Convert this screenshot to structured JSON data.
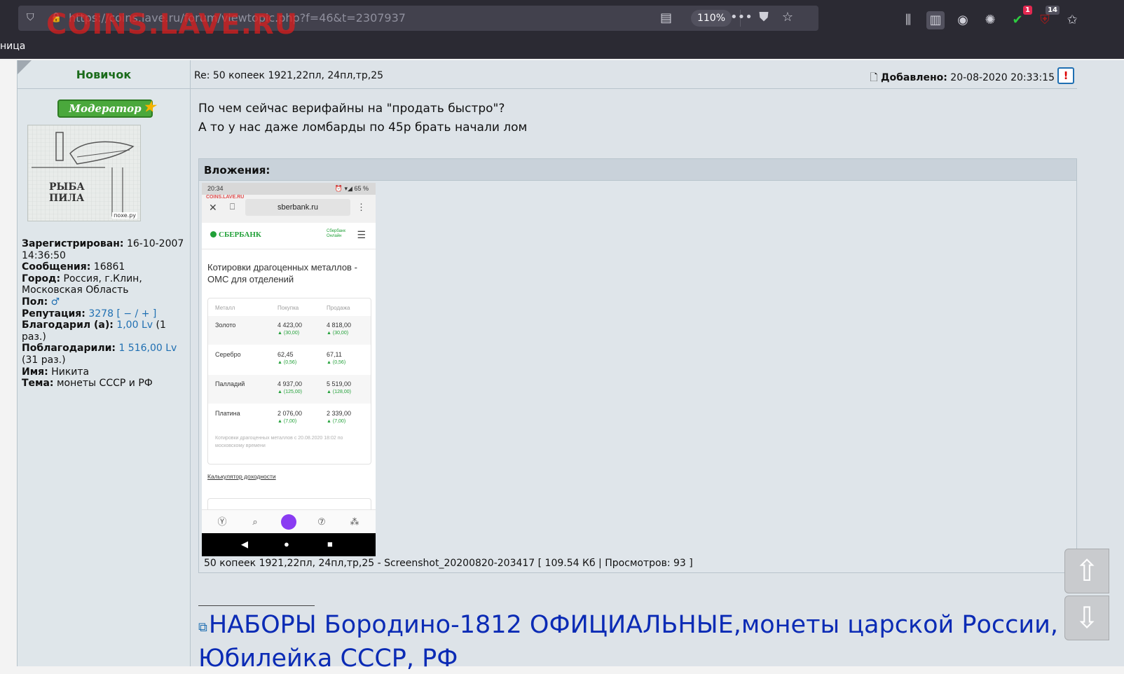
{
  "browser": {
    "url": "https://coins.lave.ru/forum/viewtopic.php?f=46&t=2307937",
    "watermark": "COINS.LAVE.RU",
    "zoom": "110%",
    "tab_fragment": "ница",
    "badges": {
      "shield": "1",
      "ublock": "14"
    },
    "icons": [
      "shield-icon",
      "lock-icon",
      "reader-view-icon",
      "more-icon",
      "pocket-icon",
      "star-icon",
      "library-icon",
      "sidebar-icon",
      "account-icon",
      "extension-icon",
      "privacy-badger-icon",
      "ublock-icon",
      "bookmark-star-icon"
    ]
  },
  "author": {
    "rank": "Новичок",
    "badge": "Модератор",
    "avatar_text_line1": "РЫБА",
    "avatar_text_line2": "ПИЛА",
    "avatar_sig": "поxe.ру",
    "registered_label": "Зарегистрирован:",
    "registered_value": "16-10-2007 14:36:50",
    "messages_label": "Сообщения:",
    "messages_value": "16861",
    "city_label": "Город:",
    "city_value": "Россия, г.Клин, Московская Область",
    "gender_label": "Пол:",
    "gender_value": "♂",
    "rep_label": "Репутация:",
    "rep_value": "3278",
    "rep_controls": "[ − / + ]",
    "thanked_label": "Благодарил (а):",
    "thanked_value": "1,00 Lv",
    "thanked_times": "(1 раз.)",
    "thanked_by_label": "Поблагодарили:",
    "thanked_by_value": "1 516,00 Lv",
    "thanked_by_times": "(31 раз.)",
    "name_label": "Имя:",
    "name_value": "Никита",
    "topic_label": "Тема:",
    "topic_value": "монеты СССР и РФ"
  },
  "post": {
    "subject": "Re: 50 копеек 1921,22пл, 24пл,тр,25",
    "added_label": "Добавлено:",
    "added_value": "20-08-2020 20:33:15",
    "report_glyph": "!",
    "line1": "По чем сейчас верифайны на \"продать быстро\"?",
    "line2": "А то у нас даже ломбарды по 45р брать начали лом",
    "attachments_title": "Вложения:",
    "attachment_caption": "50 копеек 1921,22пл, 24пл,тр,25 - Screenshot_20200820-203417 [ 109.54 Кб | Просмотров: 93 ]"
  },
  "phone": {
    "time": "20:34",
    "status_right": "⏰ ▾◢ 65 %",
    "watermark": "COINS.LAVE.RU",
    "url": "sberbank.ru",
    "bank": "СБЕРБАНК",
    "online": "Сбербанк Онлайн",
    "heading": "Котировки драгоценных металлов - ОМС для отделений",
    "col_metal": "Металл",
    "col_buy": "Покупка",
    "col_sell": "Продажа",
    "rows": [
      {
        "metal": "Золото",
        "buy": "4 423,00",
        "buy_delta": "▲ (30,00)",
        "sell": "4 818,00",
        "sell_delta": "▲ (30,00)"
      },
      {
        "metal": "Серебро",
        "buy": "62,45",
        "buy_delta": "▲ (0,56)",
        "sell": "67,11",
        "sell_delta": "▲ (0,56)"
      },
      {
        "metal": "Палладий",
        "buy": "4 937,00",
        "buy_delta": "▲ (125,00)",
        "sell": "5 519,00",
        "sell_delta": "▲ (128,00)"
      },
      {
        "metal": "Платина",
        "buy": "2 076,00",
        "buy_delta": "▲ (7,00)",
        "sell": "2 339,00",
        "sell_delta": "▲ (7,00)"
      }
    ],
    "note": "Котировки драгоценных металлов с 20.08.2020 18:02 по московскому времени",
    "calc_link": "Калькулятор доходности"
  },
  "signature": {
    "link_text": "НАБОРЫ Бородино-1812 ОФИЦИАЛЬНЫЕ,монеты царской России,",
    "link_text_2": "Юбилейка СССР, РФ"
  },
  "scroll": {
    "up": "⇧",
    "down": "⇩"
  }
}
